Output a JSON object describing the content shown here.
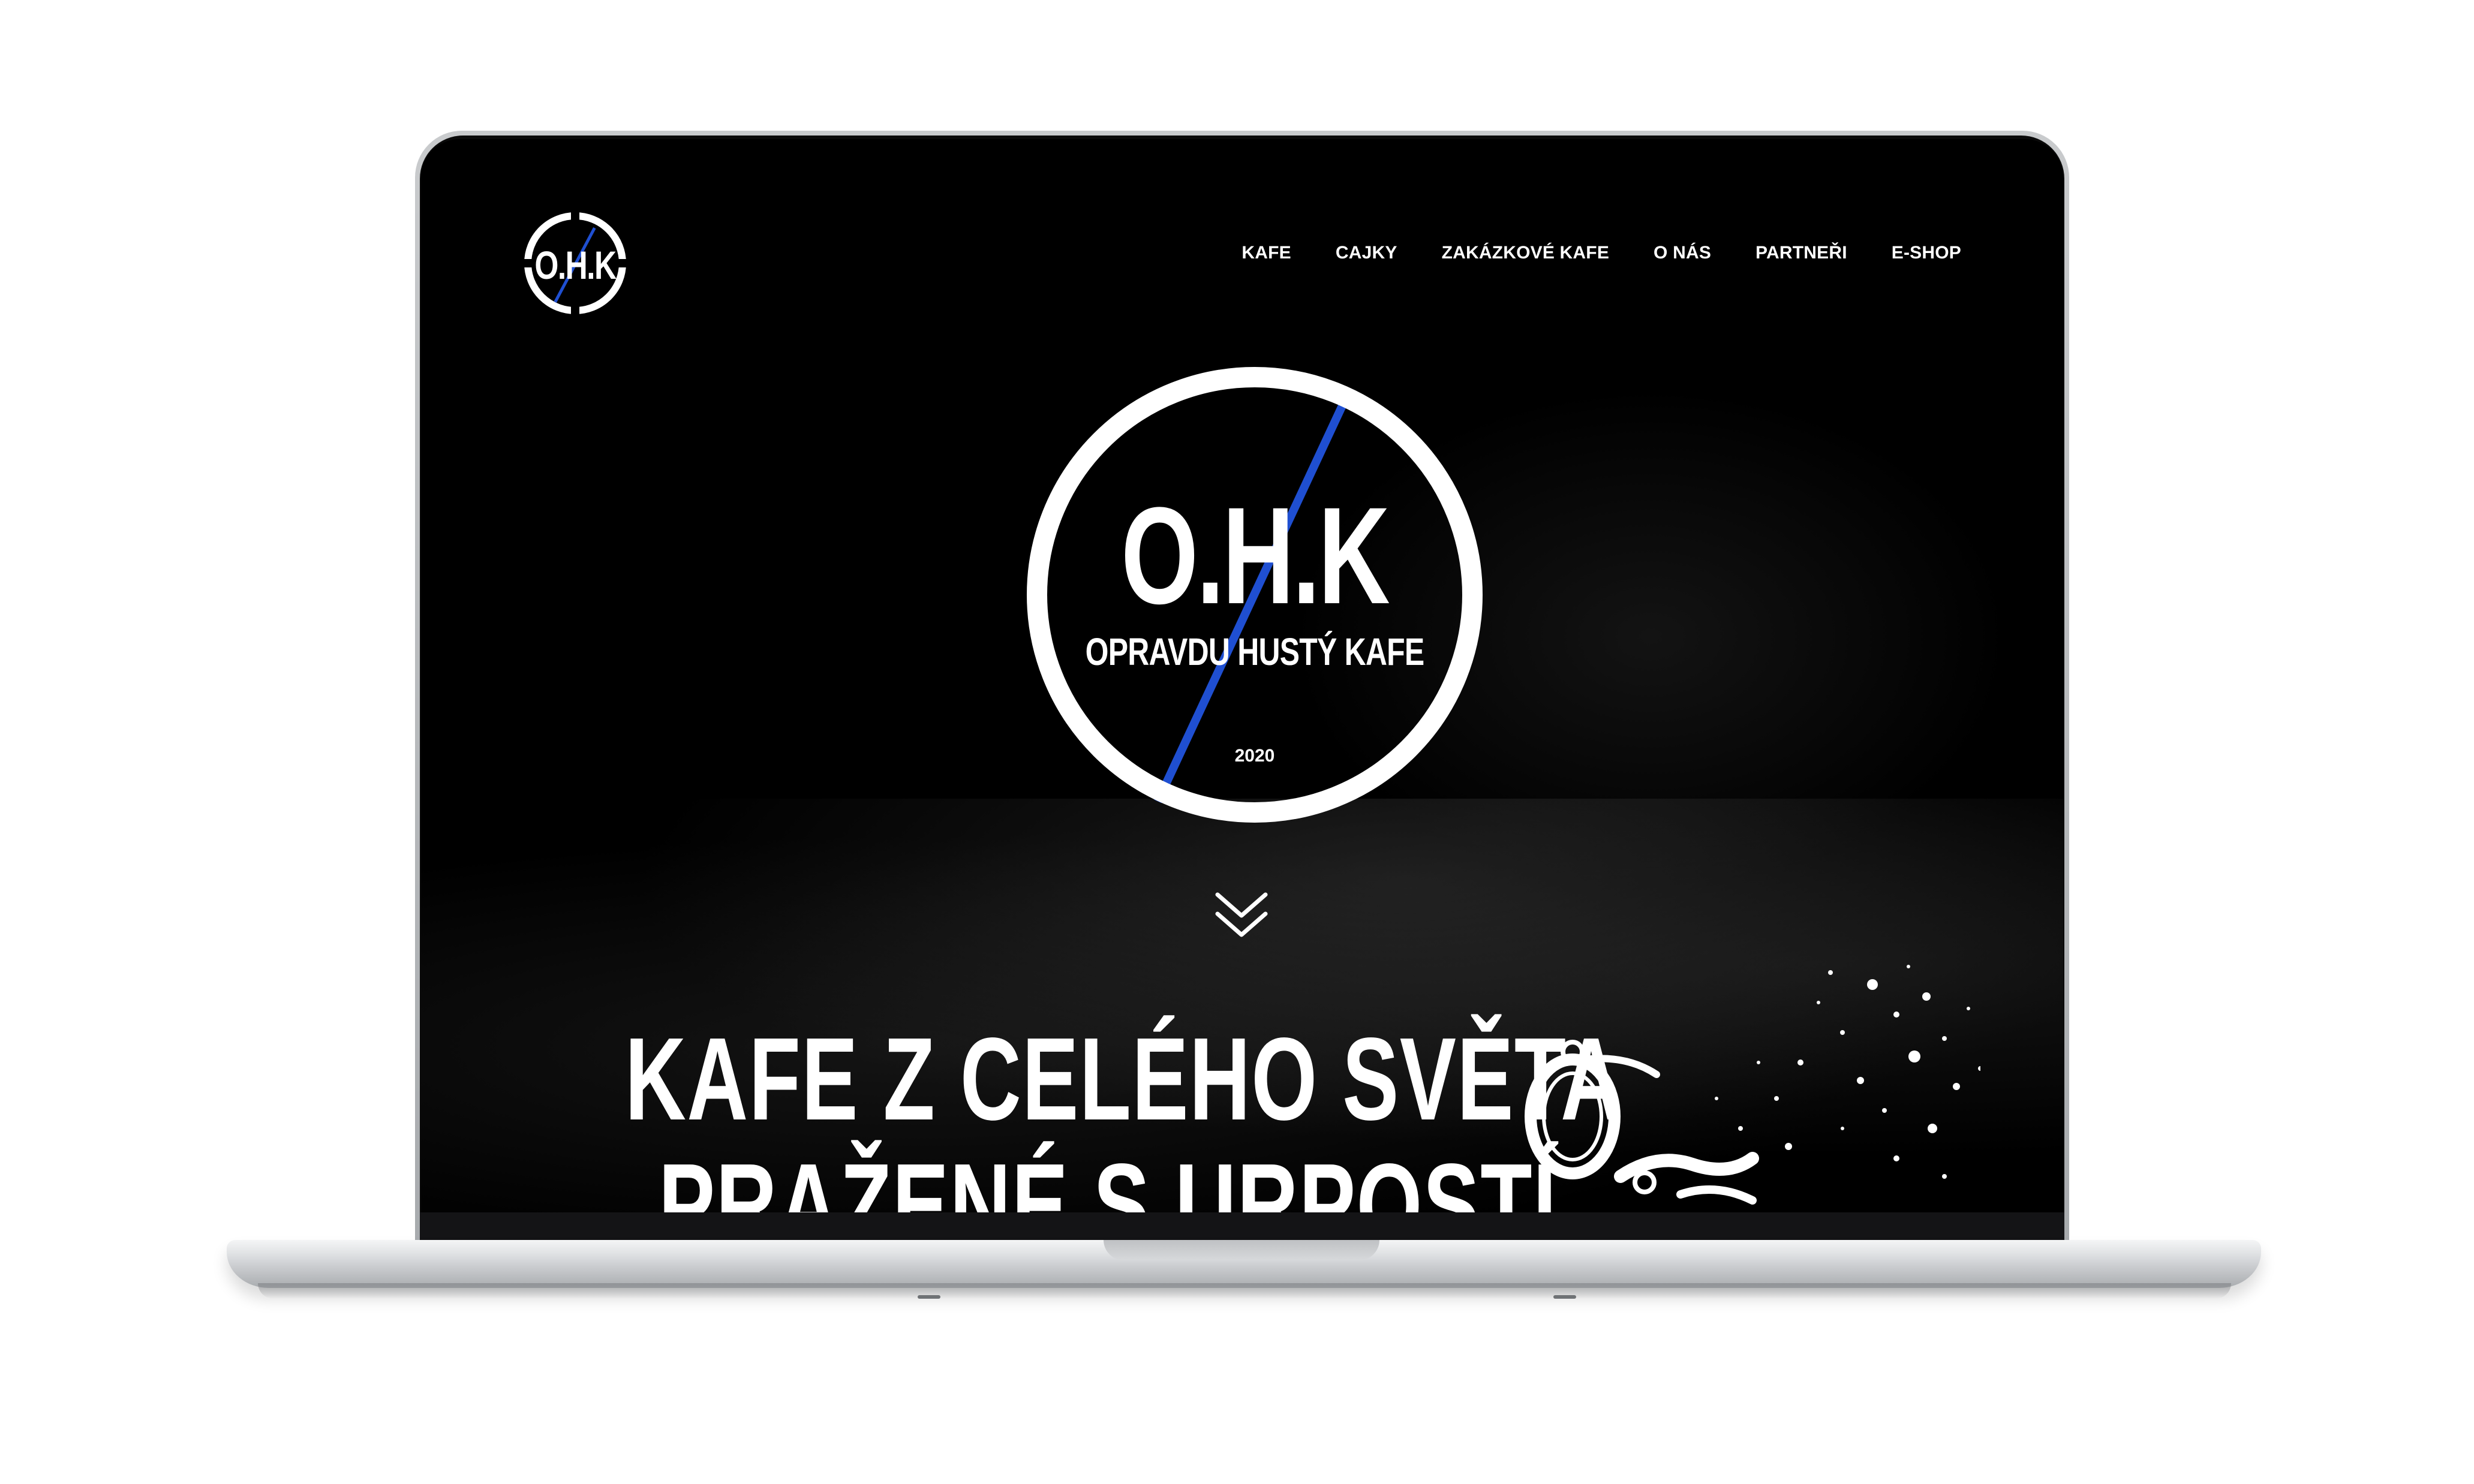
{
  "header": {
    "logo_text": "O.H.K",
    "nav": [
      "KAFE",
      "CAJKY",
      "ZAKÁZKOVÉ KAFE",
      "O NÁS",
      "PARTNEŘI",
      "E-SHOP"
    ]
  },
  "hero_logo": {
    "main_text": "O.H.K",
    "sub_text": "OPRAVDU HUSTÝ KAFE",
    "year": "2020"
  },
  "hero": {
    "title_line1": "KAFE Z CELÉHO SVĚTA",
    "title_line2": "PRAŽENÉ S URPOSTÍ"
  },
  "colors": {
    "background": "#000000",
    "accent_blue": "#1f4fd1",
    "text": "#ffffff"
  },
  "icons": [
    "scroll-down-chevron-icon",
    "handcuff-icon"
  ]
}
